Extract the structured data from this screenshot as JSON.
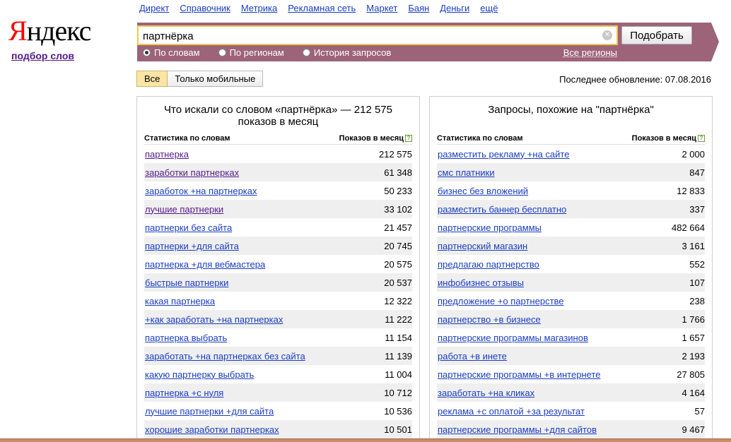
{
  "logo": {
    "first": "Я",
    "rest": "ндекс"
  },
  "subtitle": "подбор слов",
  "services": [
    "Директ",
    "Справочник",
    "Метрика",
    "Рекламная сеть",
    "Маркет",
    "Баян",
    "Деньги",
    "ещё"
  ],
  "search": {
    "value": "партнёрка",
    "submit_label": "Подобрать",
    "clear_icon": "close-icon"
  },
  "radios": [
    {
      "label": "По словам",
      "checked": true
    },
    {
      "label": "По регионам",
      "checked": false
    },
    {
      "label": "История запросов",
      "checked": false
    }
  ],
  "regions_link": "Все регионы",
  "tabs": [
    {
      "label": "Все",
      "active": true
    },
    {
      "label": "Только мобильные",
      "active": false
    }
  ],
  "updated": "Последнее обновление: 07.08.2016",
  "left_panel": {
    "title": "Что искали со словом «партнёрка» — 212 575 показов в месяц",
    "col_words": "Статистика по словам",
    "col_count": "Показов в месяц",
    "rows": [
      {
        "phrase": "партнерка",
        "count": "212 575",
        "visited": true
      },
      {
        "phrase": "заработки партнерках",
        "count": "61 348",
        "visited": true
      },
      {
        "phrase": "заработок +на партнерках",
        "count": "50 233",
        "visited": false
      },
      {
        "phrase": "лучшие партнерки",
        "count": "33 102",
        "visited": true
      },
      {
        "phrase": "партнерки без сайта",
        "count": "21 457",
        "visited": false
      },
      {
        "phrase": "партнерки +для сайта",
        "count": "20 745",
        "visited": false
      },
      {
        "phrase": "партнерка +для вебмастера",
        "count": "20 575",
        "visited": false
      },
      {
        "phrase": "быстрые партнерки",
        "count": "20 537",
        "visited": false
      },
      {
        "phrase": "какая партнерка",
        "count": "12 322",
        "visited": false
      },
      {
        "phrase": "+как заработать +на партнерках",
        "count": "11 222",
        "visited": false
      },
      {
        "phrase": "партнерка выбрать",
        "count": "11 154",
        "visited": false
      },
      {
        "phrase": "заработать +на партнерках без сайта",
        "count": "11 139",
        "visited": false
      },
      {
        "phrase": "какую партнерку выбрать",
        "count": "11 004",
        "visited": false
      },
      {
        "phrase": "партнерка +с нуля",
        "count": "10 712",
        "visited": false
      },
      {
        "phrase": "лучшие партнерки +для сайта",
        "count": "10 536",
        "visited": false
      },
      {
        "phrase": "хорошие заработки партнерках",
        "count": "10 501",
        "visited": false
      }
    ]
  },
  "right_panel": {
    "title": "Запросы, похожие на \"партнёрка\"",
    "col_words": "Статистика по словам",
    "col_count": "Показов в месяц",
    "rows": [
      {
        "phrase": "разместить рекламу +на сайте",
        "count": "2 000"
      },
      {
        "phrase": "смс платники",
        "count": "847"
      },
      {
        "phrase": "бизнес без вложений",
        "count": "12 833"
      },
      {
        "phrase": "разместить баннер бесплатно",
        "count": "337"
      },
      {
        "phrase": "партнерские программы",
        "count": "482 664"
      },
      {
        "phrase": "партнерский магазин",
        "count": "3 161"
      },
      {
        "phrase": "предлагаю партнерство",
        "count": "552"
      },
      {
        "phrase": "инфобизнес отзывы",
        "count": "107"
      },
      {
        "phrase": "предложение +о партнерстве",
        "count": "238"
      },
      {
        "phrase": "партнерство +в бизнесе",
        "count": "1 766"
      },
      {
        "phrase": "партнерские программы магазинов",
        "count": "1 657"
      },
      {
        "phrase": "работа +в инете",
        "count": "2 193"
      },
      {
        "phrase": "партнерские программы +в интернете",
        "count": "27 805"
      },
      {
        "phrase": "заработать +на кликах",
        "count": "4 164"
      },
      {
        "phrase": "реклама +с оплатой +за результат",
        "count": "57"
      },
      {
        "phrase": "партнерские программы +для сайтов",
        "count": "9 467"
      }
    ]
  },
  "colors": {
    "band": "#9d6379",
    "link": "#1a3dc1",
    "visited": "#551a8b",
    "logo_red": "#ff0000",
    "active_tab": "#fbe5a5"
  }
}
